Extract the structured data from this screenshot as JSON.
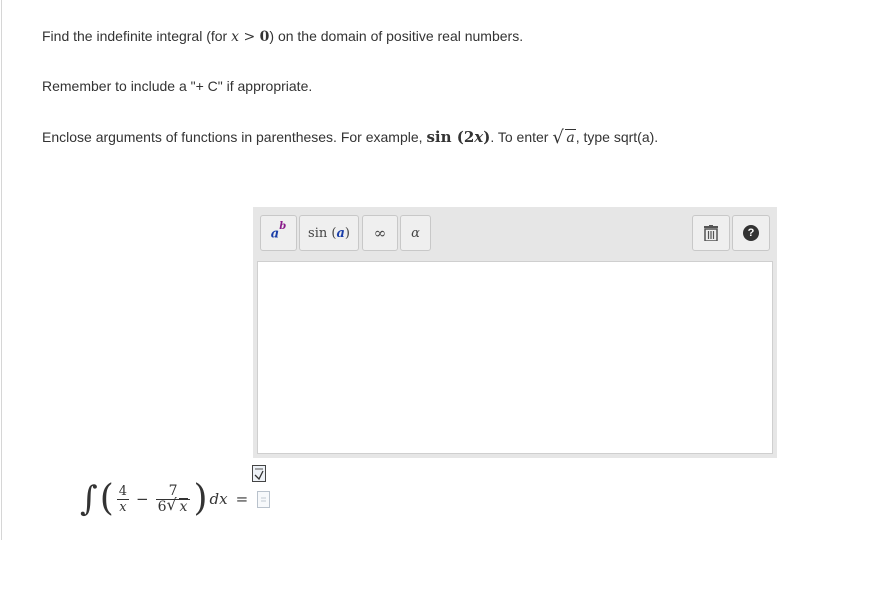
{
  "instructions": {
    "line1_prefix": "Find the indefinite integral (for ",
    "line1_var": "x",
    "line1_gt": " > ",
    "line1_zero": "0",
    "line1_suffix": ") on the domain of positive real numbers.",
    "line2": "Remember to include a \"+ C\" if appropriate.",
    "line3_prefix": "Enclose arguments of functions in parentheses. For example, ",
    "line3_example_func": "sin",
    "line3_example_open": " (2",
    "line3_example_var": "x",
    "line3_example_close": ")",
    "line3_mid": ". To enter ",
    "line3_sqrt_var": "a",
    "line3_suffix": ", type sqrt(a)."
  },
  "toolbar": {
    "power_base": "a",
    "power_exp": "b",
    "sin_label": "sin",
    "sin_open": "(",
    "sin_arg": "a",
    "sin_close": ")",
    "infinity_label": "∞",
    "alpha_label": "α",
    "help_label": "?"
  },
  "answer": {
    "value": ""
  },
  "problem": {
    "integral_sign": "∫",
    "open_paren": "(",
    "frac1_num": "4",
    "frac1_den": "x",
    "minus": "−",
    "frac2_num": "7",
    "frac2_den_coef": "6",
    "frac2_den_var": "x",
    "close_paren": ")",
    "dx": "dx",
    "equals": "="
  },
  "colors": {
    "accent": "#1a3ea8",
    "power_base": "#1a3ea8",
    "power_exp": "#8a1a8a"
  },
  "icons": [
    "power-icon",
    "trash-icon",
    "help-icon",
    "document-icon",
    "page-icon"
  ]
}
